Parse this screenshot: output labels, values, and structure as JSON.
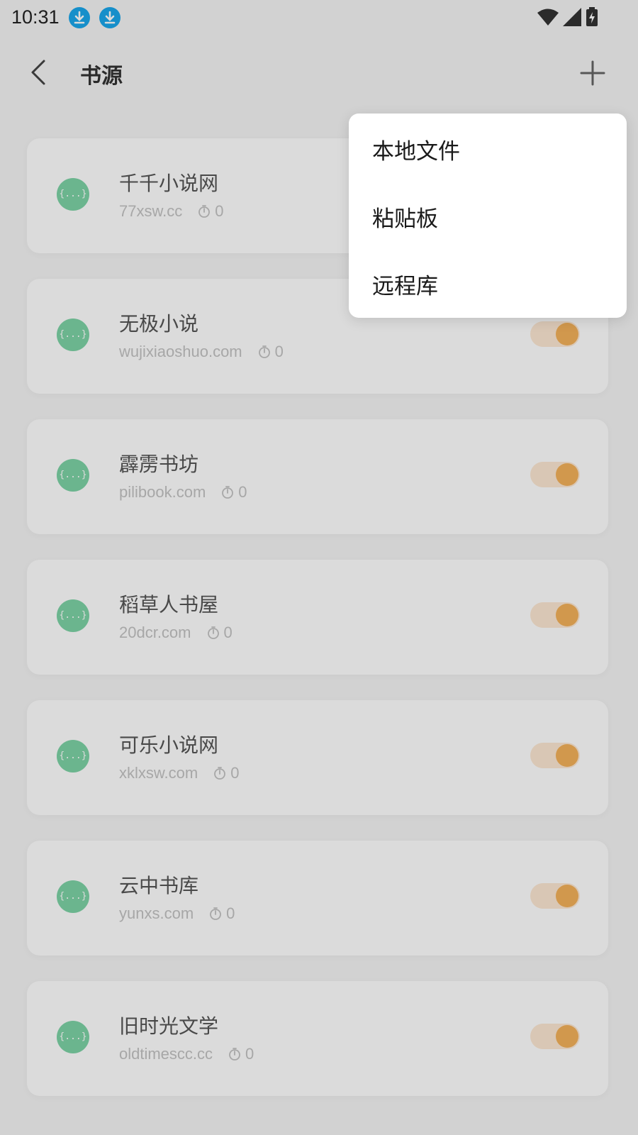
{
  "status": {
    "time": "10:31",
    "icons": [
      "download-icon",
      "download-icon",
      "wifi-icon",
      "signal-icon",
      "battery-charging-icon"
    ]
  },
  "header": {
    "title": "书源",
    "back_icon": "chevron-left-icon",
    "add_icon": "plus-icon"
  },
  "sources": [
    {
      "name": "千千小说网",
      "domain": "77xsw.cc",
      "count": "0",
      "enabled": true
    },
    {
      "name": "无极小说",
      "domain": "wujixiaoshuo.com",
      "count": "0",
      "enabled": true
    },
    {
      "name": "霹雳书坊",
      "domain": "pilibook.com",
      "count": "0",
      "enabled": true
    },
    {
      "name": "稻草人书屋",
      "domain": "20dcr.com",
      "count": "0",
      "enabled": true
    },
    {
      "name": "可乐小说网",
      "domain": "xklxsw.com",
      "count": "0",
      "enabled": true
    },
    {
      "name": "云中书库",
      "domain": "yunxs.com",
      "count": "0",
      "enabled": true
    },
    {
      "name": "旧时光文学",
      "domain": "oldtimescc.cc",
      "count": "0",
      "enabled": true
    }
  ],
  "source_icon_glyph": "{...}",
  "menu": {
    "items": [
      "本地文件",
      "粘贴板",
      "远程库"
    ]
  },
  "colors": {
    "accent": "#f4b25a",
    "source_icon": "#7dd3a6",
    "download_badge": "#1aa7ec"
  }
}
